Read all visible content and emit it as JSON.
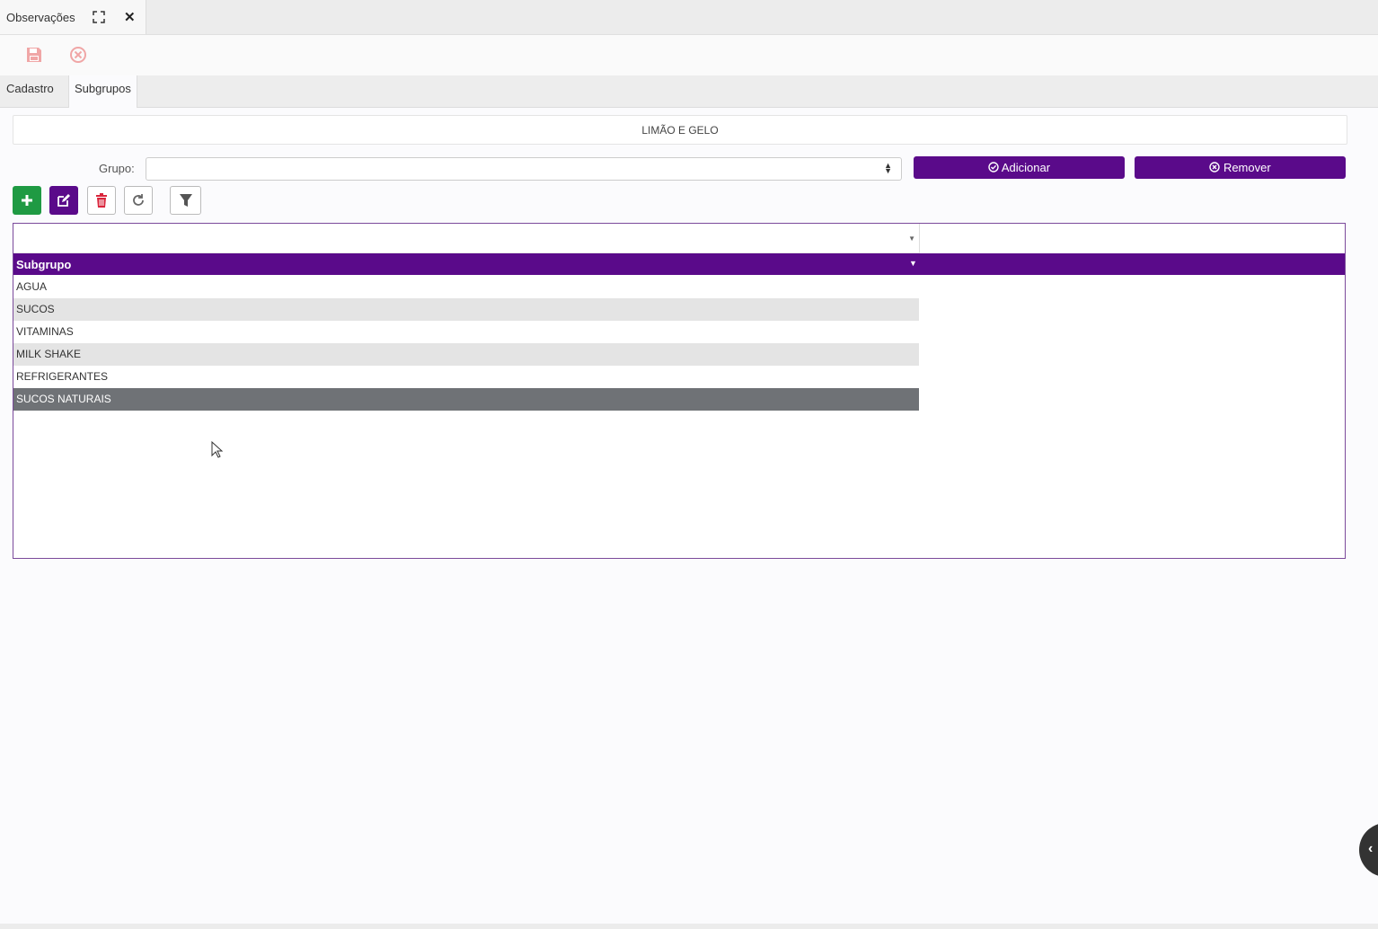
{
  "window_tab": {
    "title": "Observações"
  },
  "tabs": [
    {
      "label": "Cadastro",
      "active": false
    },
    {
      "label": "Subgrupos",
      "active": true
    }
  ],
  "record": {
    "title": "LIMÃO E GELO"
  },
  "grupo": {
    "label": "Grupo:",
    "value": ""
  },
  "buttons": {
    "add_label": "Adicionar",
    "remove_label": "Remover"
  },
  "grid": {
    "column_header": "Subgrupo",
    "rows": [
      {
        "label": "AGUA",
        "state": "normal"
      },
      {
        "label": "SUCOS",
        "state": "alt"
      },
      {
        "label": "VITAMINAS",
        "state": "normal"
      },
      {
        "label": "MILK SHAKE",
        "state": "alt"
      },
      {
        "label": "REFRIGERANTES",
        "state": "normal"
      },
      {
        "label": "SUCOS NATURAIS",
        "state": "selected"
      }
    ]
  },
  "colors": {
    "accent": "#5a0a8a",
    "add_green": "#1f9a43",
    "delete_red": "#d9243b",
    "selected_row": "#6f7276",
    "toolbar_icon": "#f0a6a6"
  },
  "icons": [
    "expand-icon",
    "close-icon",
    "save-icon",
    "cancel-circle-icon",
    "check-circle-icon",
    "x-circle-icon",
    "plus-icon",
    "edit-icon",
    "trash-icon",
    "refresh-icon",
    "filter-icon",
    "chevron-left-icon"
  ]
}
